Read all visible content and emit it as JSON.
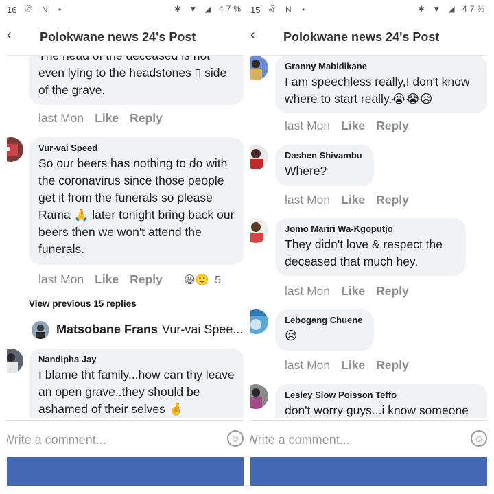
{
  "left": {
    "status": {
      "time": "16",
      "notif_icons": "ঐ N •",
      "sys_icons": "✱ ▼ ◢ 47%"
    },
    "header": {
      "back": "‹",
      "title": "Polokwane news 24's Post"
    },
    "comments": [
      {
        "author": "",
        "text": "The head of the deceased is not even lying to the headstones ▯ side of the grave.",
        "time": "last Mon",
        "like": "Like",
        "reply": "Reply"
      },
      {
        "author": "Vur-vai Speed",
        "text": "So our beers has nothing to do with the coronavirus since those people get it from the funerals so please Rama 🙏 later tonight bring back our beers then we won't attend the funerals.",
        "time": "last Mon",
        "like": "Like",
        "reply": "Reply",
        "reactions": "😆🙂",
        "reaction_count": "5"
      },
      {
        "author": "Nandipha Jay",
        "text": "I blame tht family...how can thy leave an open grave..they should be ashamed of their selves 🤞"
      }
    ],
    "view_previous": "View previous 15 replies",
    "reply_preview": {
      "name": "Matsobane Frans",
      "text": "Vur-vai Spee..."
    },
    "composer": {
      "placeholder": "Write a comment...",
      "emoji": "☺"
    }
  },
  "right": {
    "status": {
      "time": "15",
      "notif_icons": "ঐ N •",
      "sys_icons": "✱ ▼ ◢ 47%"
    },
    "header": {
      "back": "‹",
      "title": "Polokwane news 24's Post"
    },
    "comments": [
      {
        "author": "Granny Mabidikane",
        "text": "I am speechless really,I don't know where to start really.😭😭😥",
        "time": "last Mon",
        "like": "Like",
        "reply": "Reply"
      },
      {
        "author": "Dashen Shivambu",
        "text": "Where?",
        "time": "last Mon",
        "like": "Like",
        "reply": "Reply"
      },
      {
        "author": "Jomo Mariri Wa-Kgoputjo",
        "text": "They didn't love & respect the deceased that much hey.",
        "time": "last Mon",
        "like": "Like",
        "reply": "Reply"
      },
      {
        "author": "Lebogang Chuene",
        "text": "😥",
        "time": "last Mon",
        "like": "Like",
        "reply": "Reply"
      },
      {
        "author": "Lesley Slow Poisson Teffo",
        "text": "don't worry guys...i know someone"
      }
    ],
    "composer": {
      "placeholder": "Write a comment...",
      "emoji": "☺"
    }
  },
  "colors": {
    "bubble": "#f0f2f5",
    "meta": "#8a8d91",
    "fb_blue": "#4568b4"
  }
}
